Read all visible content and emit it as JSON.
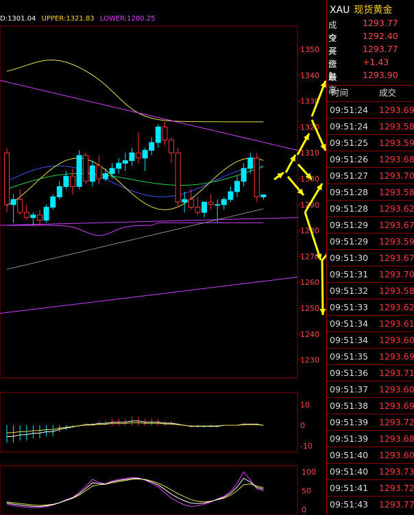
{
  "legend": {
    "mid": "D:1301.04",
    "upper": "UPPER:1321.83",
    "lower": "LOWER:1280.25"
  },
  "colors": {
    "bull": "#00e8ff",
    "bear": "#ff3434",
    "grid": "#8b0000",
    "axis_text": "#ff4a4a",
    "boll_upper": "#e8e04a",
    "boll_lower": "#d040ff",
    "arrow": "#ffff00"
  },
  "price_axis": {
    "ticks": [
      "1350",
      "1340",
      "1330",
      "1320",
      "1310",
      "1300",
      "1290",
      "1280",
      "1270",
      "1260",
      "1250",
      "1240",
      "1230"
    ]
  },
  "macd_axis": {
    "ticks": [
      "10",
      "0",
      "-10"
    ]
  },
  "kdj_axis": {
    "ticks": [
      "100",
      "50",
      "0"
    ]
  },
  "quote": {
    "symbol": "XAU",
    "name": "现货黄金",
    "rows": [
      {
        "label": "成交",
        "value": "1293.77"
      },
      {
        "label": "今开",
        "value": "1292.40"
      },
      {
        "label": "买价1",
        "value": "1293.77"
      },
      {
        "label": "涨跌",
        "value": "+1.43"
      },
      {
        "label": "最高",
        "value": "1293.90"
      }
    ]
  },
  "trades_header": {
    "time": "时间",
    "price": "成交"
  },
  "trades": [
    {
      "time": "09:51:24",
      "price": "1293.69"
    },
    {
      "time": "09:51:24",
      "price": "1293.58"
    },
    {
      "time": "09:51:25",
      "price": "1293.59"
    },
    {
      "time": "09:51:26",
      "price": "1293.68"
    },
    {
      "time": "09:51:27",
      "price": "1293.70"
    },
    {
      "time": "09:51:28",
      "price": "1293.58"
    },
    {
      "time": "09:51:28",
      "price": "1293.62"
    },
    {
      "time": "09:51:29",
      "price": "1293.67"
    },
    {
      "time": "09:51:29",
      "price": "1293.59"
    },
    {
      "time": "09:51:30",
      "price": "1293.67"
    },
    {
      "time": "09:51:31",
      "price": "1293.70"
    },
    {
      "time": "09:51:32",
      "price": "1293.58"
    },
    {
      "time": "09:51:33",
      "price": "1293.62"
    },
    {
      "time": "09:51:34",
      "price": "1293.61"
    },
    {
      "time": "09:51:34",
      "price": "1293.60"
    },
    {
      "time": "09:51:35",
      "price": "1293.69"
    },
    {
      "time": "09:51:36",
      "price": "1293.71"
    },
    {
      "time": "09:51:37",
      "price": "1293.60"
    },
    {
      "time": "09:51:38",
      "price": "1293.69"
    },
    {
      "time": "09:51:39",
      "price": "1293.72"
    },
    {
      "time": "09:51:39",
      "price": "1293.68"
    },
    {
      "time": "09:51:40",
      "price": "1293.60"
    },
    {
      "time": "09:51:40",
      "price": "1293.73"
    },
    {
      "time": "09:51:41",
      "price": "1293.72"
    },
    {
      "time": "09:51:43",
      "price": "1293.77"
    }
  ],
  "candles": [
    {
      "o": 1310,
      "h": 1312,
      "l": 1287,
      "c": 1290
    },
    {
      "o": 1290,
      "h": 1294,
      "l": 1283,
      "c": 1292
    },
    {
      "o": 1292,
      "h": 1296,
      "l": 1286,
      "c": 1287
    },
    {
      "o": 1287,
      "h": 1290,
      "l": 1284,
      "c": 1285
    },
    {
      "o": 1285,
      "h": 1287,
      "l": 1282,
      "c": 1286
    },
    {
      "o": 1286,
      "h": 1288,
      "l": 1282,
      "c": 1284
    },
    {
      "o": 1284,
      "h": 1290,
      "l": 1283,
      "c": 1289
    },
    {
      "o": 1289,
      "h": 1294,
      "l": 1288,
      "c": 1293
    },
    {
      "o": 1293,
      "h": 1299,
      "l": 1292,
      "c": 1297
    },
    {
      "o": 1297,
      "h": 1303,
      "l": 1296,
      "c": 1301
    },
    {
      "o": 1301,
      "h": 1304,
      "l": 1294,
      "c": 1297
    },
    {
      "o": 1297,
      "h": 1311,
      "l": 1296,
      "c": 1309
    },
    {
      "o": 1309,
      "h": 1310,
      "l": 1298,
      "c": 1299
    },
    {
      "o": 1299,
      "h": 1307,
      "l": 1297,
      "c": 1305
    },
    {
      "o": 1305,
      "h": 1309,
      "l": 1298,
      "c": 1300
    },
    {
      "o": 1300,
      "h": 1304,
      "l": 1299,
      "c": 1302
    },
    {
      "o": 1302,
      "h": 1306,
      "l": 1300,
      "c": 1304
    },
    {
      "o": 1304,
      "h": 1308,
      "l": 1302,
      "c": 1306
    },
    {
      "o": 1306,
      "h": 1310,
      "l": 1303,
      "c": 1307
    },
    {
      "o": 1307,
      "h": 1312,
      "l": 1305,
      "c": 1310
    },
    {
      "o": 1310,
      "h": 1318,
      "l": 1306,
      "c": 1308
    },
    {
      "o": 1308,
      "h": 1312,
      "l": 1303,
      "c": 1311
    },
    {
      "o": 1311,
      "h": 1316,
      "l": 1309,
      "c": 1314
    },
    {
      "o": 1314,
      "h": 1321,
      "l": 1312,
      "c": 1320
    },
    {
      "o": 1320,
      "h": 1322,
      "l": 1313,
      "c": 1315
    },
    {
      "o": 1315,
      "h": 1316,
      "l": 1306,
      "c": 1310
    },
    {
      "o": 1310,
      "h": 1312,
      "l": 1289,
      "c": 1291
    },
    {
      "o": 1291,
      "h": 1295,
      "l": 1287,
      "c": 1292
    },
    {
      "o": 1292,
      "h": 1296,
      "l": 1288,
      "c": 1289
    },
    {
      "o": 1289,
      "h": 1293,
      "l": 1286,
      "c": 1287
    },
    {
      "o": 1287,
      "h": 1291,
      "l": 1285,
      "c": 1291
    },
    {
      "o": 1291,
      "h": 1294,
      "l": 1288,
      "c": 1290
    },
    {
      "o": 1290,
      "h": 1292,
      "l": 1283,
      "c": 1290
    },
    {
      "o": 1290,
      "h": 1293,
      "l": 1288,
      "c": 1292
    },
    {
      "o": 1292,
      "h": 1297,
      "l": 1291,
      "c": 1295
    },
    {
      "o": 1295,
      "h": 1301,
      "l": 1293,
      "c": 1299
    },
    {
      "o": 1299,
      "h": 1306,
      "l": 1297,
      "c": 1304
    },
    {
      "o": 1304,
      "h": 1310,
      "l": 1302,
      "c": 1308
    },
    {
      "o": 1308,
      "h": 1310,
      "l": 1291,
      "c": 1293
    },
    {
      "o": 1293,
      "h": 1294,
      "l": 1292,
      "c": 1293.8
    }
  ],
  "macd_hist": [
    -8,
    -8,
    -7,
    -7,
    -6,
    -6,
    -5,
    -5,
    -3,
    -2,
    -1,
    0,
    1,
    1,
    2,
    2,
    3,
    3,
    3,
    4,
    4,
    3,
    3,
    3,
    2,
    2,
    1,
    0,
    -1,
    -1,
    -1,
    -1,
    -1,
    0,
    0,
    0,
    1,
    1,
    1,
    0
  ],
  "kdj_k": [
    15,
    10,
    8,
    6,
    5,
    5,
    8,
    12,
    18,
    26,
    32,
    45,
    62,
    80,
    72,
    68,
    76,
    80,
    82,
    85,
    84,
    78,
    70,
    60,
    45,
    30,
    20,
    12,
    8,
    10,
    14,
    20,
    28,
    35,
    48,
    70,
    100,
    78,
    55,
    50
  ],
  "kdj_d": [
    20,
    18,
    16,
    14,
    12,
    11,
    12,
    14,
    18,
    24,
    30,
    38,
    50,
    62,
    66,
    67,
    71,
    74,
    77,
    80,
    81,
    80,
    76,
    70,
    62,
    52,
    42,
    34,
    26,
    22,
    20,
    22,
    26,
    30,
    38,
    50,
    66,
    68,
    62,
    58
  ]
}
